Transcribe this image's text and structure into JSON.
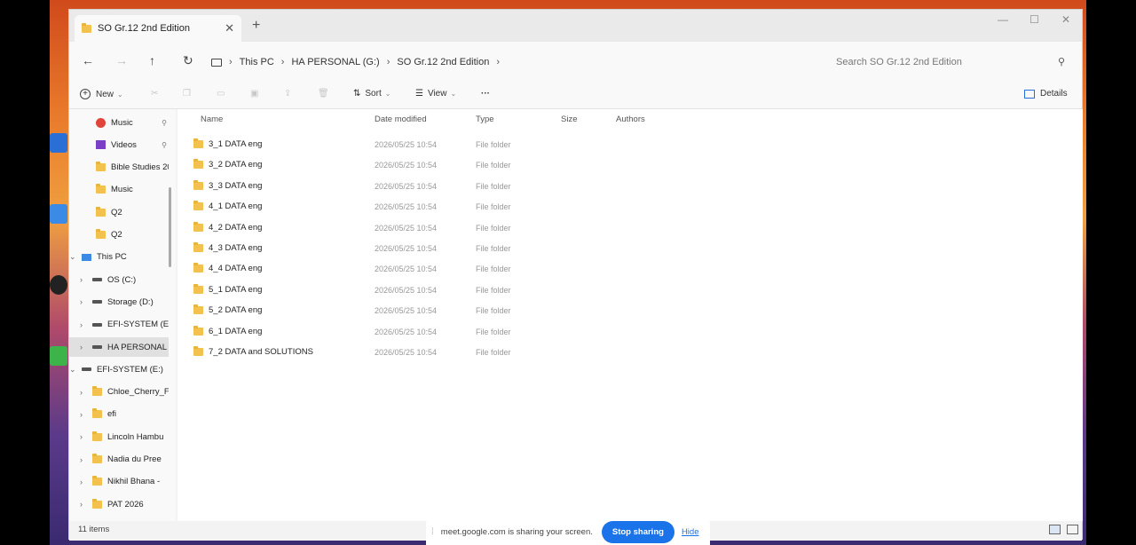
{
  "tab": {
    "title": "SO Gr.12 2nd Edition",
    "close": "✕",
    "new_tab": "+"
  },
  "window_controls": {
    "minimize": "—",
    "maximize": "☐",
    "close": "✕"
  },
  "nav": {
    "back": "←",
    "forward": "→",
    "up": "↑",
    "refresh": "↻"
  },
  "breadcrumb": [
    "This PC",
    "HA PERSONAL (G:)",
    "SO Gr.12 2nd Edition"
  ],
  "search": {
    "placeholder": "Search SO Gr.12 2nd Edition"
  },
  "toolbar": {
    "new": "New",
    "sort": "Sort",
    "view": "View",
    "more": "···",
    "details": "Details"
  },
  "sidebar": {
    "items": [
      {
        "label": "Music",
        "icon": "music-icon",
        "pinned": true
      },
      {
        "label": "Videos",
        "icon": "videos-icon",
        "pinned": true
      },
      {
        "label": "Bible Studies 20",
        "icon": "folder-icon"
      },
      {
        "label": "Music",
        "icon": "folder-icon"
      },
      {
        "label": "Q2",
        "icon": "folder-icon"
      },
      {
        "label": "Q2",
        "icon": "folder-icon"
      },
      {
        "label": "This PC",
        "icon": "pc-icon",
        "expanded": true
      },
      {
        "label": "OS (C:)",
        "icon": "drive-icon"
      },
      {
        "label": "Storage (D:)",
        "icon": "drive-icon"
      },
      {
        "label": "EFI-SYSTEM (E",
        "icon": "drive-icon"
      },
      {
        "label": "HA PERSONAL",
        "icon": "drive-icon",
        "selected": true
      },
      {
        "label": "EFI-SYSTEM (E:)",
        "icon": "drive-icon",
        "expanded": true
      },
      {
        "label": "Chloe_Cherry_F",
        "icon": "folder-icon"
      },
      {
        "label": "efi",
        "icon": "folder-icon"
      },
      {
        "label": "Lincoln Hambu",
        "icon": "folder-icon"
      },
      {
        "label": "Nadia du Pree",
        "icon": "folder-icon"
      },
      {
        "label": "Nikhil Bhana -",
        "icon": "folder-icon"
      },
      {
        "label": "PAT 2026",
        "icon": "folder-icon"
      }
    ]
  },
  "columns": {
    "name": "Name",
    "date": "Date modified",
    "type": "Type",
    "size": "Size",
    "authors": "Authors"
  },
  "files": [
    {
      "name": "3_1 DATA eng",
      "date": "2026/05/25 10:54",
      "type": "File folder"
    },
    {
      "name": "3_2 DATA eng",
      "date": "2026/05/25 10:54",
      "type": "File folder"
    },
    {
      "name": "3_3 DATA eng",
      "date": "2026/05/25 10:54",
      "type": "File folder"
    },
    {
      "name": "4_1 DATA eng",
      "date": "2026/05/25 10:54",
      "type": "File folder"
    },
    {
      "name": "4_2 DATA eng",
      "date": "2026/05/25 10:54",
      "type": "File folder"
    },
    {
      "name": "4_3 DATA eng",
      "date": "2026/05/25 10:54",
      "type": "File folder"
    },
    {
      "name": "4_4 DATA eng",
      "date": "2026/05/25 10:54",
      "type": "File folder"
    },
    {
      "name": "5_1 DATA eng",
      "date": "2026/05/25 10:54",
      "type": "File folder"
    },
    {
      "name": "5_2 DATA eng",
      "date": "2026/05/25 10:54",
      "type": "File folder"
    },
    {
      "name": "6_1 DATA eng",
      "date": "2026/05/25 10:54",
      "type": "File folder"
    },
    {
      "name": "7_2 DATA and SOLUTIONS",
      "date": "2026/05/25 10:54",
      "type": "File folder"
    }
  ],
  "status": {
    "count": "11 items"
  },
  "share_bar": {
    "grip": "⁞",
    "message": "meet.google.com is sharing your screen.",
    "stop": "Stop sharing",
    "hide": "Hide"
  }
}
